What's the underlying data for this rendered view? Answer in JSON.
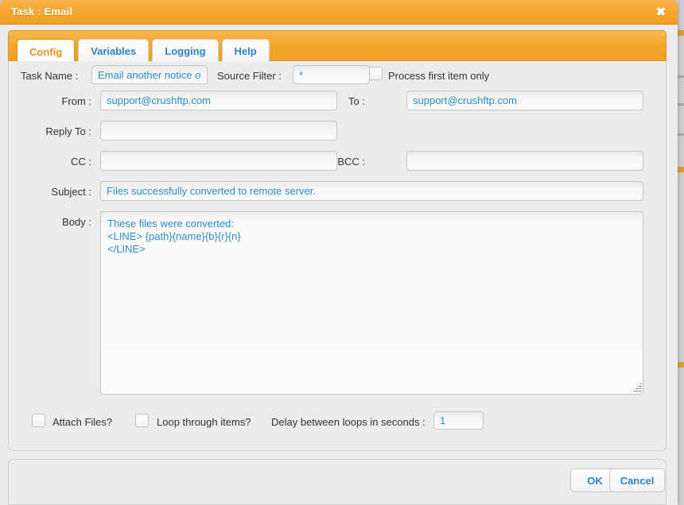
{
  "window": {
    "title": "Task : Email",
    "close_icon": "close-icon",
    "close_glyph": "✖"
  },
  "tabs": [
    {
      "label": "Config",
      "active": true
    },
    {
      "label": "Variables",
      "active": false
    },
    {
      "label": "Logging",
      "active": false
    },
    {
      "label": "Help",
      "active": false
    }
  ],
  "form": {
    "task_name_label": "Task Name :",
    "task_name_value": "Email another notice of converted files",
    "source_filter_label": "Source Filter :",
    "source_filter_value": "*",
    "process_first_item_label": "Process first item only",
    "process_first_item_checked": false,
    "from_label": "From :",
    "from_value": "support@crushftp.com",
    "to_label": "To :",
    "to_value": "support@crushftp.com",
    "reply_to_label": "Reply To :",
    "reply_to_value": "",
    "cc_label": "CC :",
    "cc_value": "",
    "bcc_label": "BCC :",
    "bcc_value": "",
    "subject_label": "Subject :",
    "subject_value": "Files successfully converted to remote server.",
    "body_label": "Body :",
    "body_value": "These files were converted:\n<LINE> {path}{name}{b}{r}{n}\n</LINE>",
    "attach_files_label": "Attach Files?",
    "attach_files_checked": false,
    "loop_through_items_label": "Loop through items?",
    "loop_through_items_checked": false,
    "delay_label": "Delay between loops in seconds :",
    "delay_value": "1"
  },
  "footer": {
    "ok_label": "OK",
    "cancel_label": "Cancel"
  },
  "colors": {
    "accent_orange": "#f5a62c",
    "field_text_blue": "#2e8bc9",
    "link_blue": "#2e83c6",
    "panel_bg": "#ececec"
  }
}
